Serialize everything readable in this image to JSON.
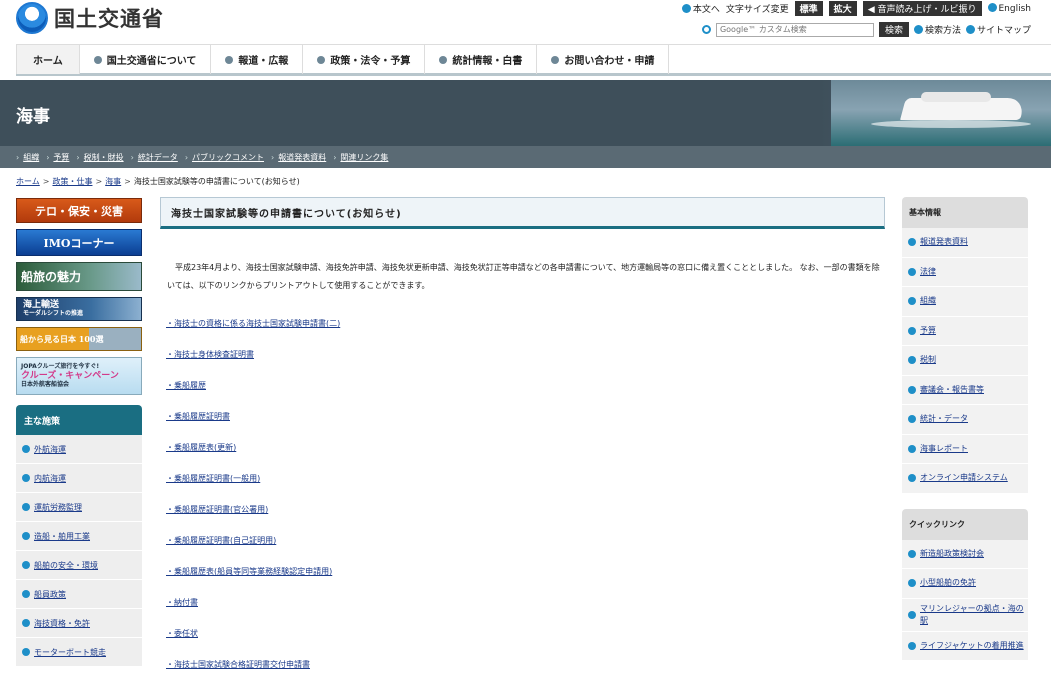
{
  "header": {
    "logo_text": "国土交通省",
    "util": {
      "main_content": "本文へ",
      "text_size_label": "文字サイズ変更",
      "size_normal": "標準",
      "size_large": "拡大",
      "voice": "音声読み上げ・ルビ振り",
      "english": "English"
    },
    "search": {
      "placeholder": "Google™ カスタム検索",
      "button": "検索",
      "method": "検索方法",
      "sitemap": "サイトマップ"
    }
  },
  "gnav": [
    "ホーム",
    "国土交通省について",
    "報道・広報",
    "政策・法令・予算",
    "統計情報・白書",
    "お問い合わせ・申請"
  ],
  "banner": {
    "title": "海事"
  },
  "subnav": [
    "組織",
    "予算",
    "税制・財投",
    "統計データ",
    "パブリックコメント",
    "報道発表資料",
    "関連リンク集"
  ],
  "breadcrumb": {
    "items": [
      "ホーム",
      "政策・仕事",
      "海事"
    ],
    "current": "海技士国家試験等の申請書について(お知らせ)"
  },
  "left": {
    "banners": {
      "b1": "テロ・保安・災害",
      "b2": "IMOコーナー",
      "b3": "船旅の魅力",
      "b4_title": "海上輸送",
      "b4_sub": "モーダルシフトの推進",
      "b5": "船から見る日本 100選",
      "b6_title": "JOPAクルーズ旅行を今すぐ!",
      "b6_main": "クルーズ・キャンペーン",
      "b6_sub": "日本外航客船協会"
    },
    "heading": "主な施策",
    "items": [
      "外航海運",
      "内航海運",
      "運航労務監理",
      "造船・舶用工業",
      "船舶の安全・環境",
      "船員政策",
      "海技資格・免許",
      "モーターボート競走"
    ]
  },
  "main": {
    "title": "海技士国家試験等の申請書について(お知らせ)",
    "intro": "平成23年4月より、海技士国家試験申請、海技免許申請、海技免状更新申請、海技免状訂正等申請などの各申請書について、地方運輸局等の窓口に備え置くこととしました。 なお、一部の書類を除いては、以下のリンクからプリントアウトして使用することができます。",
    "documents": [
      "・海技士の資格に係る海技士国家試験申請書(二)",
      "・海技士身体検査証明書",
      "・乗船履歴",
      "・乗船履歴証明書",
      "・乗船履歴表(更新)",
      "・乗船履歴証明書(一般用)",
      "・乗船履歴証明書(官公署用)",
      "・乗船履歴証明書(自己証明用)",
      "・乗船履歴表(船員等同等業務経験認定申請用)",
      "・納付書",
      "・委任状",
      "・海技士国家試験合格証明書交付申請書"
    ]
  },
  "right": {
    "basic_heading": "基本情報",
    "basic_items": [
      "報道発表資料",
      "法律",
      "組織",
      "予算",
      "税制",
      "審議会・報告書等",
      "統計・データ",
      "海事レポート",
      "オンライン申請システム"
    ],
    "quick_heading": "クイックリンク",
    "quick_items": [
      "新造船政策検討会",
      "小型船舶の免許",
      "マリンレジャーの拠点・海の駅",
      "ライフジャケットの着用推進"
    ]
  }
}
